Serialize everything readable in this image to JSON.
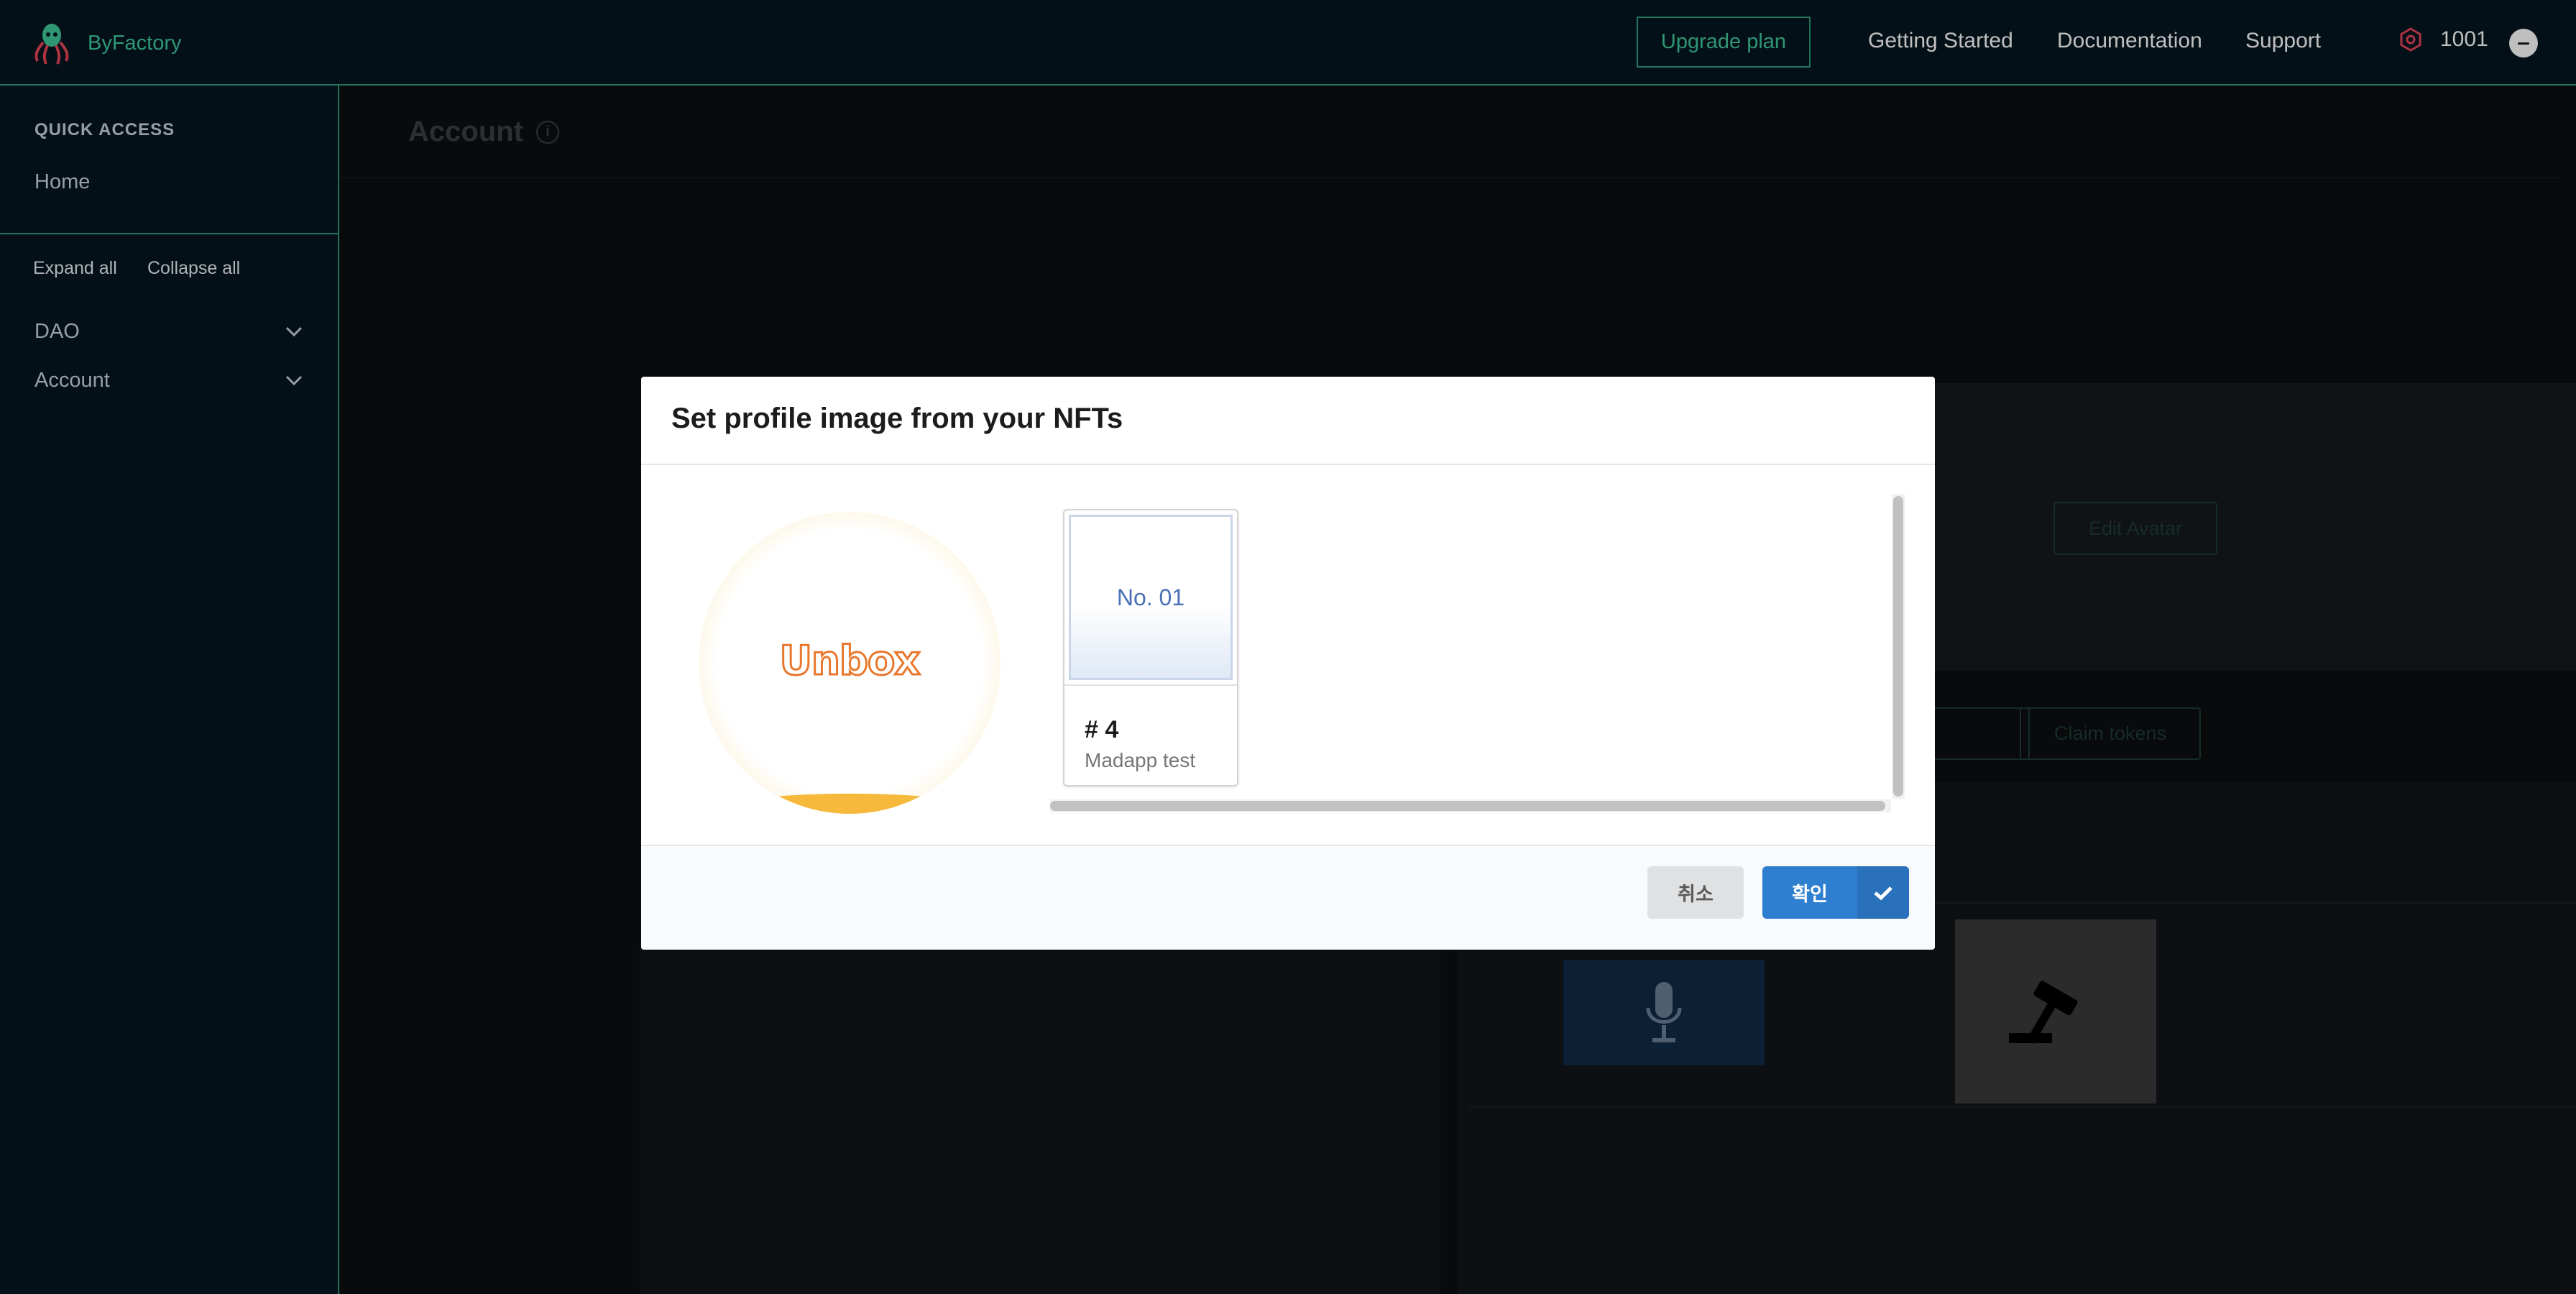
{
  "app": {
    "brand_name": "ByFactory",
    "upgrade_label": "Upgrade plan",
    "nav": [
      "Getting Started",
      "Documentation",
      "Support"
    ],
    "credits": "1001",
    "accent_color": "#3fc89b",
    "credit_icon_color": "#e8455a"
  },
  "sidebar": {
    "quick_access_title": "QUICK ACCESS",
    "home_label": "Home",
    "expand_all": "Expand all",
    "collapse_all": "Collapse all",
    "groups": [
      {
        "label": "DAO",
        "icon": "chevron-down-icon"
      },
      {
        "label": "Account",
        "icon": "chevron-down-icon"
      }
    ]
  },
  "page": {
    "title": "Account",
    "background_buttons": [
      "Edit Avatar",
      "Claim tokens"
    ]
  },
  "modal": {
    "title": "Set profile image from your NFTs",
    "preview_text": "Unbox",
    "nft": {
      "thumb_label": "No. 01",
      "number": "# 4",
      "collection": "Madapp test"
    },
    "cancel_label": "취소",
    "confirm_label": "확인",
    "confirm_color": "#2f7fd1"
  }
}
